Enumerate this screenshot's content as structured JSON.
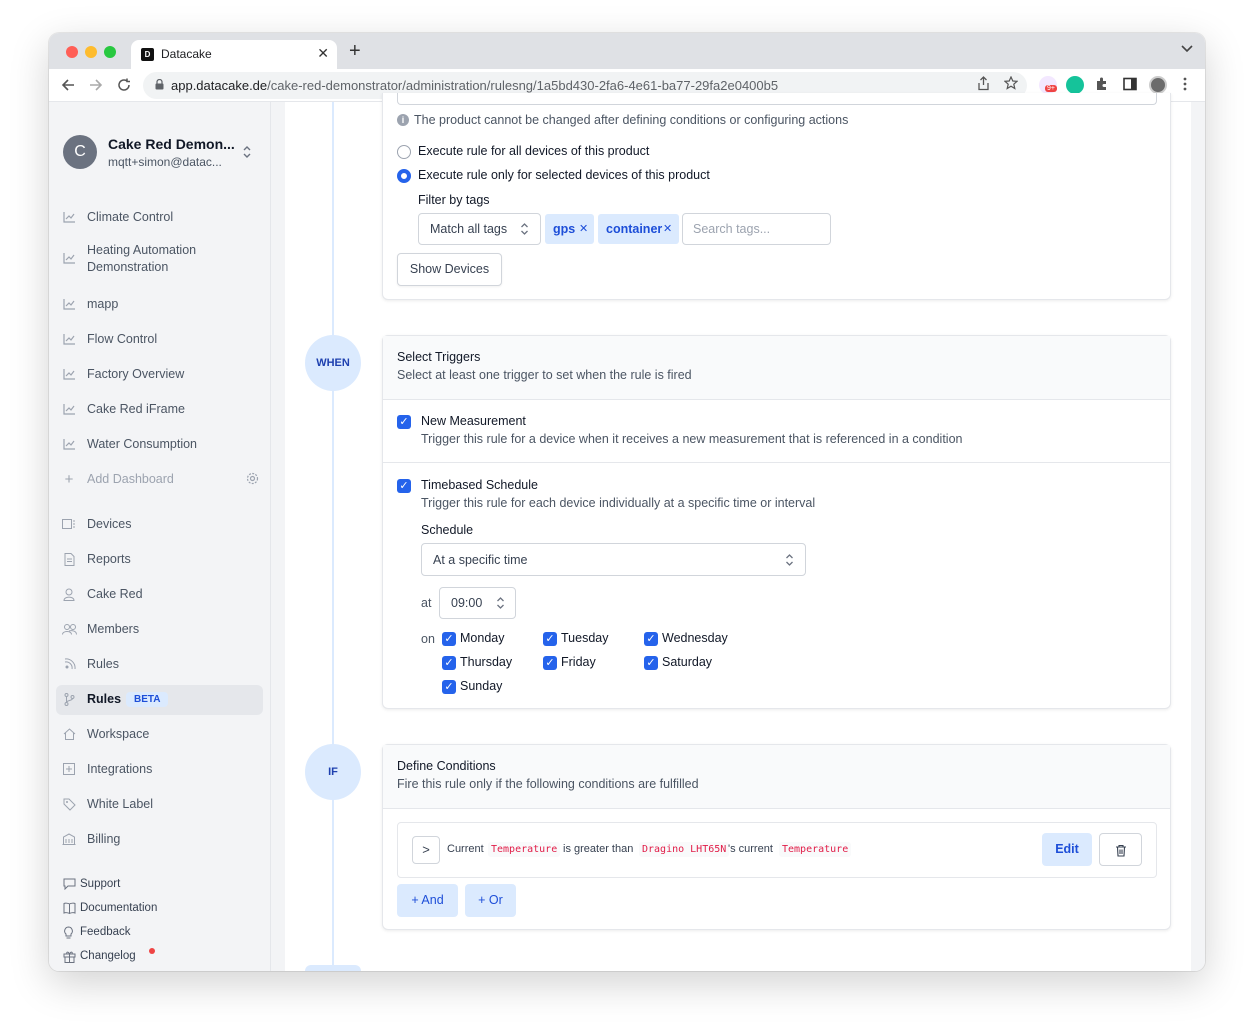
{
  "browser": {
    "tab_title": "Datacake",
    "url_domain": "app.datacake.de",
    "url_path": "/cake-red-demonstrator/administration/rulesng/1a5bd430-2fa6-4e61-ba77-29fa2e0400b5",
    "tab_close": "✕",
    "new_tab": "+",
    "ext_badge": "9+"
  },
  "sidebar": {
    "workspace_initial": "C",
    "workspace_name": "Cake Red Demon...",
    "workspace_user": "mqtt+simon@datac...",
    "dashboards": [
      {
        "label": "Climate Control"
      },
      {
        "label": "Heating Automation Demonstration"
      },
      {
        "label": "mapp"
      },
      {
        "label": "Flow Control"
      },
      {
        "label": "Factory Overview"
      },
      {
        "label": "Cake Red iFrame"
      },
      {
        "label": "Water Consumption"
      }
    ],
    "add_dashboard": "Add Dashboard",
    "items": [
      {
        "label": "Devices"
      },
      {
        "label": "Reports"
      },
      {
        "label": "Cake Red"
      },
      {
        "label": "Members"
      },
      {
        "label": "Rules"
      },
      {
        "label": "Rules",
        "badge": "BETA"
      },
      {
        "label": "Workspace"
      },
      {
        "label": "Integrations"
      },
      {
        "label": "White Label"
      },
      {
        "label": "Billing"
      }
    ],
    "footer": [
      {
        "label": "Support"
      },
      {
        "label": "Documentation"
      },
      {
        "label": "Feedback"
      },
      {
        "label": "Changelog"
      }
    ]
  },
  "product_section": {
    "info": "The product cannot be changed after defining conditions or configuring actions",
    "option_all": "Execute rule for all devices of this product",
    "option_selected": "Execute rule only for selected devices of this product",
    "filter_label": "Filter by tags",
    "match_mode": "Match all tags",
    "tags": [
      "gps",
      "container"
    ],
    "tag_remove": "✕",
    "search_placeholder": "Search tags...",
    "show_devices": "Show Devices"
  },
  "when": {
    "badge": "WHEN",
    "title": "Select Triggers",
    "subtitle": "Select at least one trigger to set when the rule is fired",
    "trigger1_title": "New Measurement",
    "trigger1_desc": "Trigger this rule for a device when it receives a new measurement that is referenced in a condition",
    "trigger2_title": "Timebased Schedule",
    "trigger2_desc": "Trigger this rule for each device individually at a specific time or interval",
    "schedule_label": "Schedule",
    "schedule_value": "At a specific time",
    "at_label": "at",
    "time_value": "09:00",
    "on_label": "on",
    "days": [
      "Monday",
      "Tuesday",
      "Wednesday",
      "Thursday",
      "Friday",
      "Saturday",
      "Sunday"
    ],
    "check": "✓"
  },
  "if": {
    "badge": "IF",
    "title": "Define Conditions",
    "subtitle": "Fire this rule only if the following conditions are fulfilled",
    "op_symbol": ">",
    "c_current": "Current",
    "c_field1": "Temperature",
    "c_greater": "is greater than",
    "c_device": "Dragino LHT65N",
    "c_possessive": "'s current",
    "c_field2": "Temperature",
    "edit": "Edit",
    "and_btn": "+ And",
    "or_btn": "+ Or"
  }
}
